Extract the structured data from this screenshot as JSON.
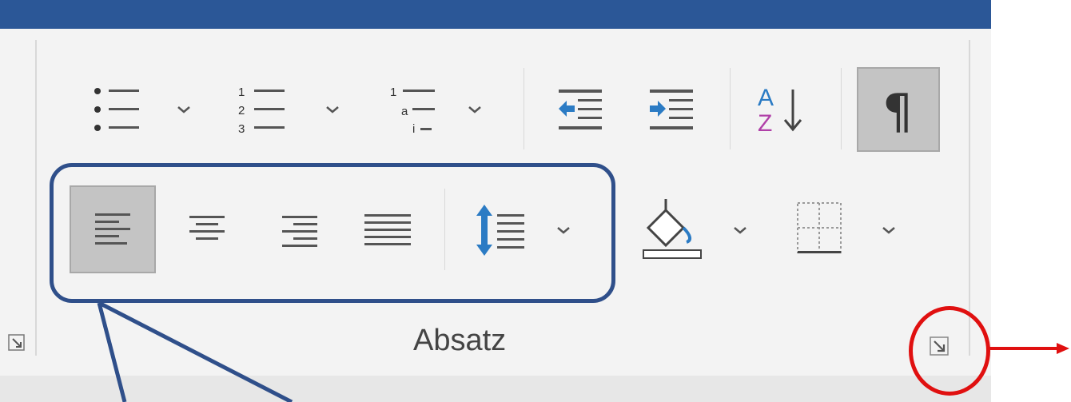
{
  "window": {
    "titlebar_color": "#2b5797"
  },
  "ribbon": {
    "group": {
      "label": "Absatz"
    },
    "row1": [
      {
        "name": "bullets-icon",
        "has_dropdown": true
      },
      {
        "name": "numbering-icon",
        "has_dropdown": true
      },
      {
        "name": "multilevel-list-icon",
        "has_dropdown": true
      },
      {
        "name": "decrease-indent-icon"
      },
      {
        "name": "increase-indent-icon"
      },
      {
        "name": "sort-icon"
      },
      {
        "name": "pilcrow-icon",
        "pressed": true
      }
    ],
    "row2": [
      {
        "name": "align-left-icon",
        "pressed": true
      },
      {
        "name": "align-center-icon"
      },
      {
        "name": "align-right-icon"
      },
      {
        "name": "justify-icon"
      },
      {
        "name": "line-spacing-icon",
        "has_dropdown": true
      },
      {
        "name": "shading-icon",
        "has_dropdown": true
      },
      {
        "name": "borders-icon",
        "has_dropdown": true
      }
    ],
    "numbering_glyphs": [
      "1",
      "2",
      "3"
    ],
    "multilevel_glyphs": [
      "1",
      "a",
      "i"
    ],
    "sort_glyphs": [
      "A",
      "Z"
    ],
    "pilcrow_glyph": "¶"
  },
  "annotations": {
    "highlight_color": "#2f4f8a",
    "circle_color": "#e01010"
  }
}
